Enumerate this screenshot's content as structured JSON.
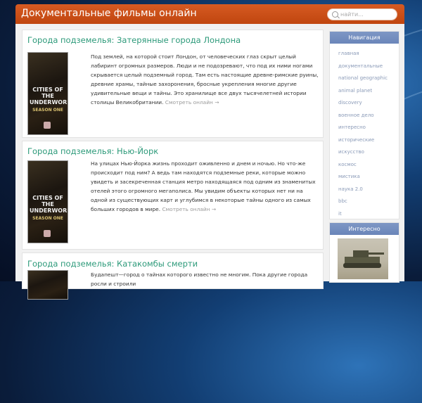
{
  "header": {
    "title": "Документальные фильмы онлайн",
    "search_placeholder": "найти..."
  },
  "posts": [
    {
      "title": "Города подземелья: Затерянные города Лондона",
      "text": "Под землей, на которой стоит Лондон, от человеческих глаз скрыт целый лабиринт огромных размеров. Люди и не подозревают, что под их ними ногами скрывается целый подземный город. Там есть настоящие древне-римские руины, древние храмы, тайные захоронения, бросные укрепления многие другие удивительные вещи и тайны. Это хранилище все двух тысячелетней истории столицы Великобритании.",
      "more": "Смотреть онлайн →",
      "cover_text": "CITIES OF THE UNDERWORLD",
      "cover_sub": "SEASON ONE"
    },
    {
      "title": "Города подземелья: Нью-Йорк",
      "text": "На улицах Нью-Йорка жизнь проходит оживленно и днем и ночью. Но что-же происходит под ним? А ведь там находятся подземные реки, которые можно увидеть и засекреченная станция метро находящаяся под одним из знаменитых отелей этого огромного мегаполиса. Мы увидим объекты которых нет ни на одной из существующих карт и углубимся в некоторые тайны одного из самых больших городов в мире.",
      "more": "Смотреть онлайн →",
      "cover_text": "CITIES OF THE UNDERWORLD",
      "cover_sub": "SEASON ONE"
    },
    {
      "title": "Города подземелья: Катакомбы смерти",
      "text": "Будапешт—город о тайнах которого известно не многим. Пока другие города росли и строили"
    }
  ],
  "sidebar": {
    "nav_title": "Навигация",
    "nav_items": [
      "главная",
      "документальные",
      "national geographic",
      "animal planet",
      "discovery",
      "военное дело",
      "интересно",
      "исторические",
      "искусство",
      "космос",
      "мистика",
      "наука 2.0",
      "bbc",
      "it"
    ],
    "interesting_title": "Интересно"
  }
}
